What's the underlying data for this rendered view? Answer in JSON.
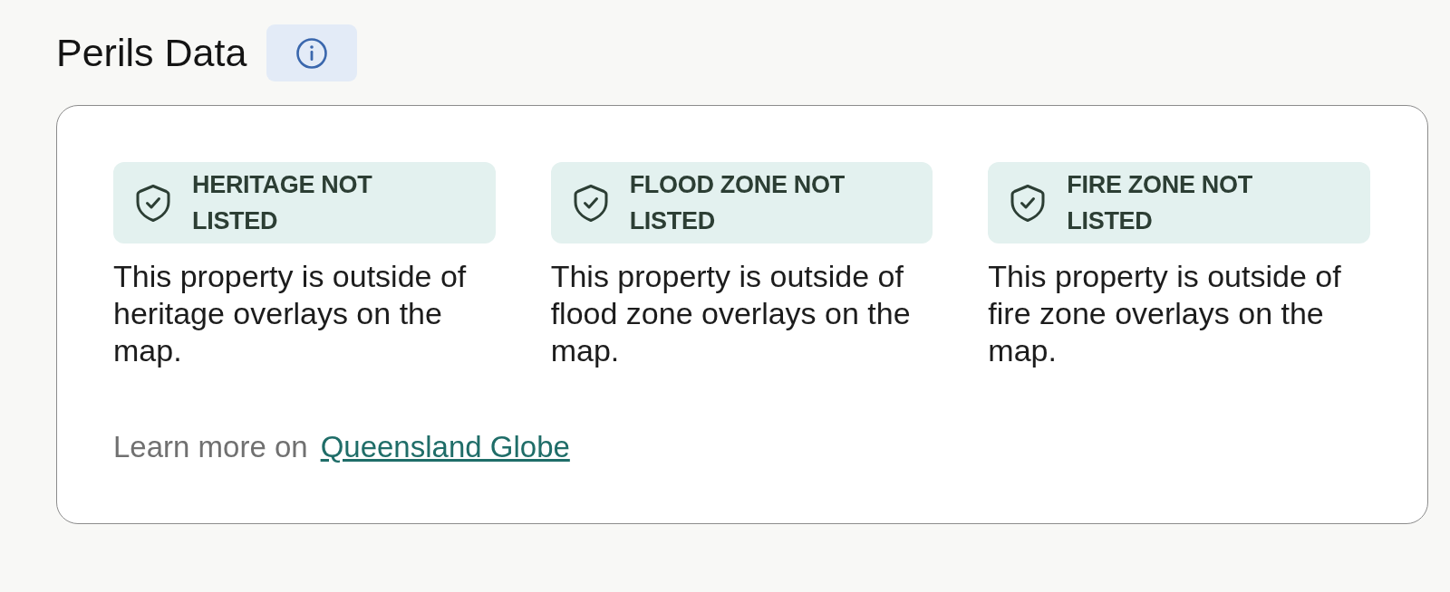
{
  "header": {
    "title": "Perils Data"
  },
  "perils": [
    {
      "status": "HERITAGE NOT LISTED",
      "description": "This property is outside of heritage overlays on the map."
    },
    {
      "status": "FLOOD ZONE NOT LISTED",
      "description": "This property is outside of flood zone overlays on the map."
    },
    {
      "status": "FIRE ZONE NOT LISTED",
      "description": "This property is outside of fire zone overlays on the map."
    }
  ],
  "footer": {
    "prefix": "Learn more on",
    "link": "Queensland Globe"
  }
}
